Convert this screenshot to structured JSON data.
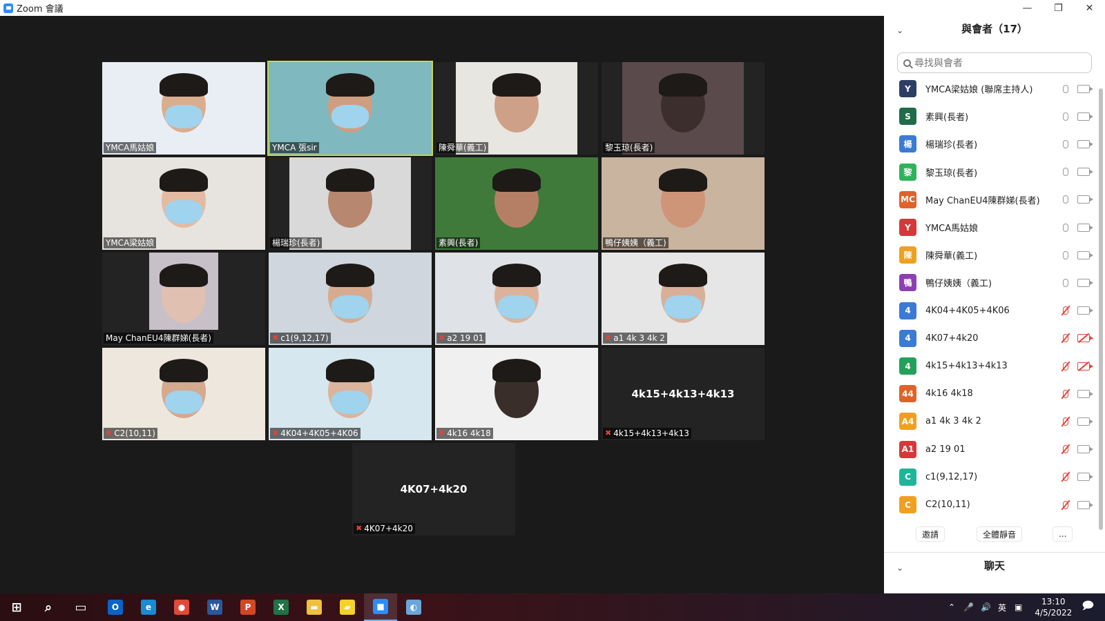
{
  "window": {
    "title": "Zoom 會議",
    "controls": [
      "minimize",
      "restore",
      "close"
    ]
  },
  "gallery": [
    {
      "name": "YMCA馬姑娘",
      "muted": false,
      "bg": "#e9eef5",
      "skin": "#d9ae8e",
      "mask": true
    },
    {
      "name": "YMCA 張sir",
      "muted": false,
      "bg": "#7fb8bf",
      "skin": "#cf9e80",
      "mask": true,
      "active": true
    },
    {
      "name": "陳舜華(義工)",
      "muted": false,
      "bg": "#e8e6e0",
      "skin": "#cfa088",
      "mask": false
    },
    {
      "name": "黎玉琼(長者)",
      "muted": false,
      "bg": "#5a4a4c",
      "skin": "#3b2e2c",
      "mask": false
    },
    {
      "name": "YMCA梁姑娘",
      "muted": false,
      "bg": "#e7e3df",
      "skin": "#e2bba2",
      "mask": true
    },
    {
      "name": "楊瑞珍(長者)",
      "muted": false,
      "bg": "#d9d9d9",
      "skin": "#b88770",
      "mask": false
    },
    {
      "name": "素興(長者)",
      "muted": false,
      "bg": "#3f7a3a",
      "skin": "#b57f66",
      "mask": false
    },
    {
      "name": "鴨仔姨姨（義工)",
      "muted": false,
      "bg": "#c9b4a0",
      "skin": "#cf9578",
      "mask": false
    },
    {
      "name": "May  ChanEU4陳群娣(長者)",
      "muted": false,
      "bg": "#c8c0c8",
      "skin": "#e0c0b0",
      "mask": false
    },
    {
      "name": "c1(9,12,17)",
      "muted": true,
      "bg": "#cfd6dd",
      "skin": "#d6ab8f",
      "mask": true
    },
    {
      "name": "a2 19 01",
      "muted": true,
      "bg": "#dfe2e6",
      "skin": "#dcb39a",
      "mask": true
    },
    {
      "name": "a1 4k 3 4k 2",
      "muted": true,
      "bg": "#e6e6e6",
      "skin": "#d8b09a",
      "mask": true
    },
    {
      "name": "C2(10,11)",
      "muted": true,
      "bg": "#eee7de",
      "skin": "#d4a98e",
      "mask": true
    },
    {
      "name": "4K04+4K05+4K06",
      "muted": true,
      "bg": "#d7e7f0",
      "skin": "#dcb49b",
      "mask": true
    },
    {
      "name": "4k16 4k18",
      "muted": true,
      "bg": "#f0f0f0",
      "skin": "#3a2e2a",
      "mask": false
    },
    {
      "name": "4k15+4k13+4k13",
      "muted": true,
      "video": false,
      "display": "4k15+4k13+4k13"
    },
    {
      "name": "4K07+4k20",
      "muted": true,
      "video": false,
      "display": "4K07+4k20"
    }
  ],
  "panel": {
    "title": "與會者（17）",
    "search_placeholder": "尋找與會者",
    "participants": [
      {
        "initial": "Y",
        "color": "#2c3e66",
        "name": "YMCA梁姑娘 (聯席主持人)",
        "mic_off": false,
        "cam_off": false
      },
      {
        "initial": "S",
        "color": "#1f6b4a",
        "name": "素興(長者)",
        "mic_off": false,
        "cam_off": false
      },
      {
        "initial": "楊",
        "color": "#3a7bd5",
        "name": "楊瑞珍(長者)",
        "mic_off": false,
        "cam_off": false
      },
      {
        "initial": "黎",
        "color": "#2fb35a",
        "name": "黎玉琼(長者)",
        "mic_off": false,
        "cam_off": false
      },
      {
        "initial": "MC",
        "color": "#e0622a",
        "name": "May  ChanEU4陳群娣(長者)",
        "mic_off": false,
        "cam_off": false
      },
      {
        "initial": "Y",
        "color": "#d6383a",
        "name": "YMCA馬姑娘",
        "mic_off": false,
        "cam_off": false
      },
      {
        "initial": "陳",
        "color": "#f0a020",
        "name": "陳舜華(義工)",
        "mic_off": false,
        "cam_off": false
      },
      {
        "initial": "鴨",
        "color": "#8a3fb3",
        "name": "鴨仔姨姨（義工)",
        "mic_off": false,
        "cam_off": false
      },
      {
        "initial": "4",
        "color": "#3a7bd5",
        "name": "4K04+4K05+4K06",
        "mic_off": true,
        "cam_off": false
      },
      {
        "initial": "4",
        "color": "#3a7bd5",
        "name": "4K07+4k20",
        "mic_off": true,
        "cam_off": true
      },
      {
        "initial": "4",
        "color": "#23a05a",
        "name": "4k15+4k13+4k13",
        "mic_off": true,
        "cam_off": true
      },
      {
        "initial": "44",
        "color": "#e0622a",
        "name": "4k16 4k18",
        "mic_off": true,
        "cam_off": false
      },
      {
        "initial": "A4",
        "color": "#f0a020",
        "name": "a1 4k 3 4k 2",
        "mic_off": true,
        "cam_off": false
      },
      {
        "initial": "A1",
        "color": "#d6383a",
        "name": "a2 19 01",
        "mic_off": true,
        "cam_off": false
      },
      {
        "initial": "C",
        "color": "#1fb59a",
        "name": "c1(9,12,17)",
        "mic_off": true,
        "cam_off": false
      },
      {
        "initial": "C",
        "color": "#f0a020",
        "name": "C2(10,11)",
        "mic_off": true,
        "cam_off": false
      }
    ],
    "invite_label": "邀請",
    "mute_all_label": "全體靜音",
    "more_label": "...",
    "chat_title": "聊天"
  },
  "taskbar": {
    "icons": [
      {
        "name": "start-icon",
        "glyph": "⊞",
        "color": ""
      },
      {
        "name": "search-icon",
        "glyph": "⌕",
        "color": ""
      },
      {
        "name": "task-view-icon",
        "glyph": "▭",
        "color": ""
      },
      {
        "name": "outlook-icon",
        "glyph": "O",
        "color": "#0a64c8"
      },
      {
        "name": "edge-icon",
        "glyph": "e",
        "color": "#1a8ad4"
      },
      {
        "name": "chrome-icon",
        "glyph": "●",
        "color": "#e04a3a"
      },
      {
        "name": "word-icon",
        "glyph": "W",
        "color": "#2b579a"
      },
      {
        "name": "powerpoint-icon",
        "glyph": "P",
        "color": "#d24726"
      },
      {
        "name": "excel-icon",
        "glyph": "X",
        "color": "#217346"
      },
      {
        "name": "file-explorer-icon",
        "glyph": "▬",
        "color": "#f0c040"
      },
      {
        "name": "sticky-notes-icon",
        "glyph": "▰",
        "color": "#f5d22a"
      },
      {
        "name": "zoom-icon",
        "glyph": "■",
        "color": "#2d8cff",
        "active": true
      },
      {
        "name": "paint-icon",
        "glyph": "◐",
        "color": "#6aa7d8"
      }
    ],
    "tray_lang": "英",
    "time": "13:10",
    "date": "4/5/2022"
  }
}
